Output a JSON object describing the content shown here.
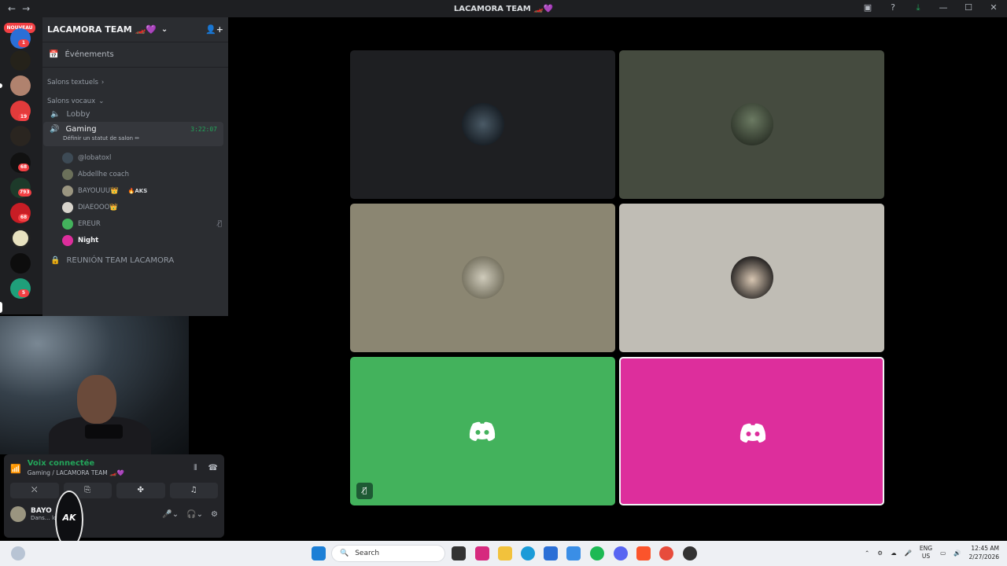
{
  "window": {
    "title": "LACAMORA TEAM 🏎️💜",
    "back": "←",
    "forward": "→"
  },
  "servers": {
    "nouveau_label": "NOUVEAU",
    "badges": [
      "1",
      "19",
      "68",
      "793",
      "68",
      "5"
    ]
  },
  "guild": {
    "name": "LACAMORA TEAM 🏎️💜",
    "events_label": "Événements",
    "text_category": "Salons textuels",
    "voice_category": "Salons vocaux",
    "channels": {
      "lobby": "Lobby",
      "gaming": "Gaming",
      "gaming_time": "3:22:07",
      "gaming_status": "Définir un statut de salon ✏",
      "reunion": "REUNIÓN TEAM LACAMORA"
    },
    "members": [
      {
        "name": "@lobatoxl",
        "extra": ""
      },
      {
        "name": "Abdellhe coach",
        "extra": ""
      },
      {
        "name": "BAYOUUU👑",
        "extra": "🔥AKS"
      },
      {
        "name": "DIAEOOO👑",
        "extra": ""
      },
      {
        "name": "EREUR",
        "extra": ""
      },
      {
        "name": "Night",
        "extra": ""
      }
    ]
  },
  "voice": {
    "status": "Voix connectée",
    "location": "Gaming / LACAMORA TEAM 🏎️💜"
  },
  "user": {
    "name": "BAYO",
    "status": "Dans… local"
  },
  "overlay_logo": "AK",
  "taskbar": {
    "search_placeholder": "Search",
    "lang": "ENG",
    "region": "US",
    "time": "12:45 AM",
    "date": "2/27/2026"
  },
  "colors": {
    "tile1": "#1e1f22",
    "tile2": "#454b3f",
    "tile3": "#8b8672",
    "tile4": "#c0bdb5",
    "tile5": "#43b25c",
    "tile6": "#dd2e9c",
    "accent_green": "#23a55a"
  }
}
